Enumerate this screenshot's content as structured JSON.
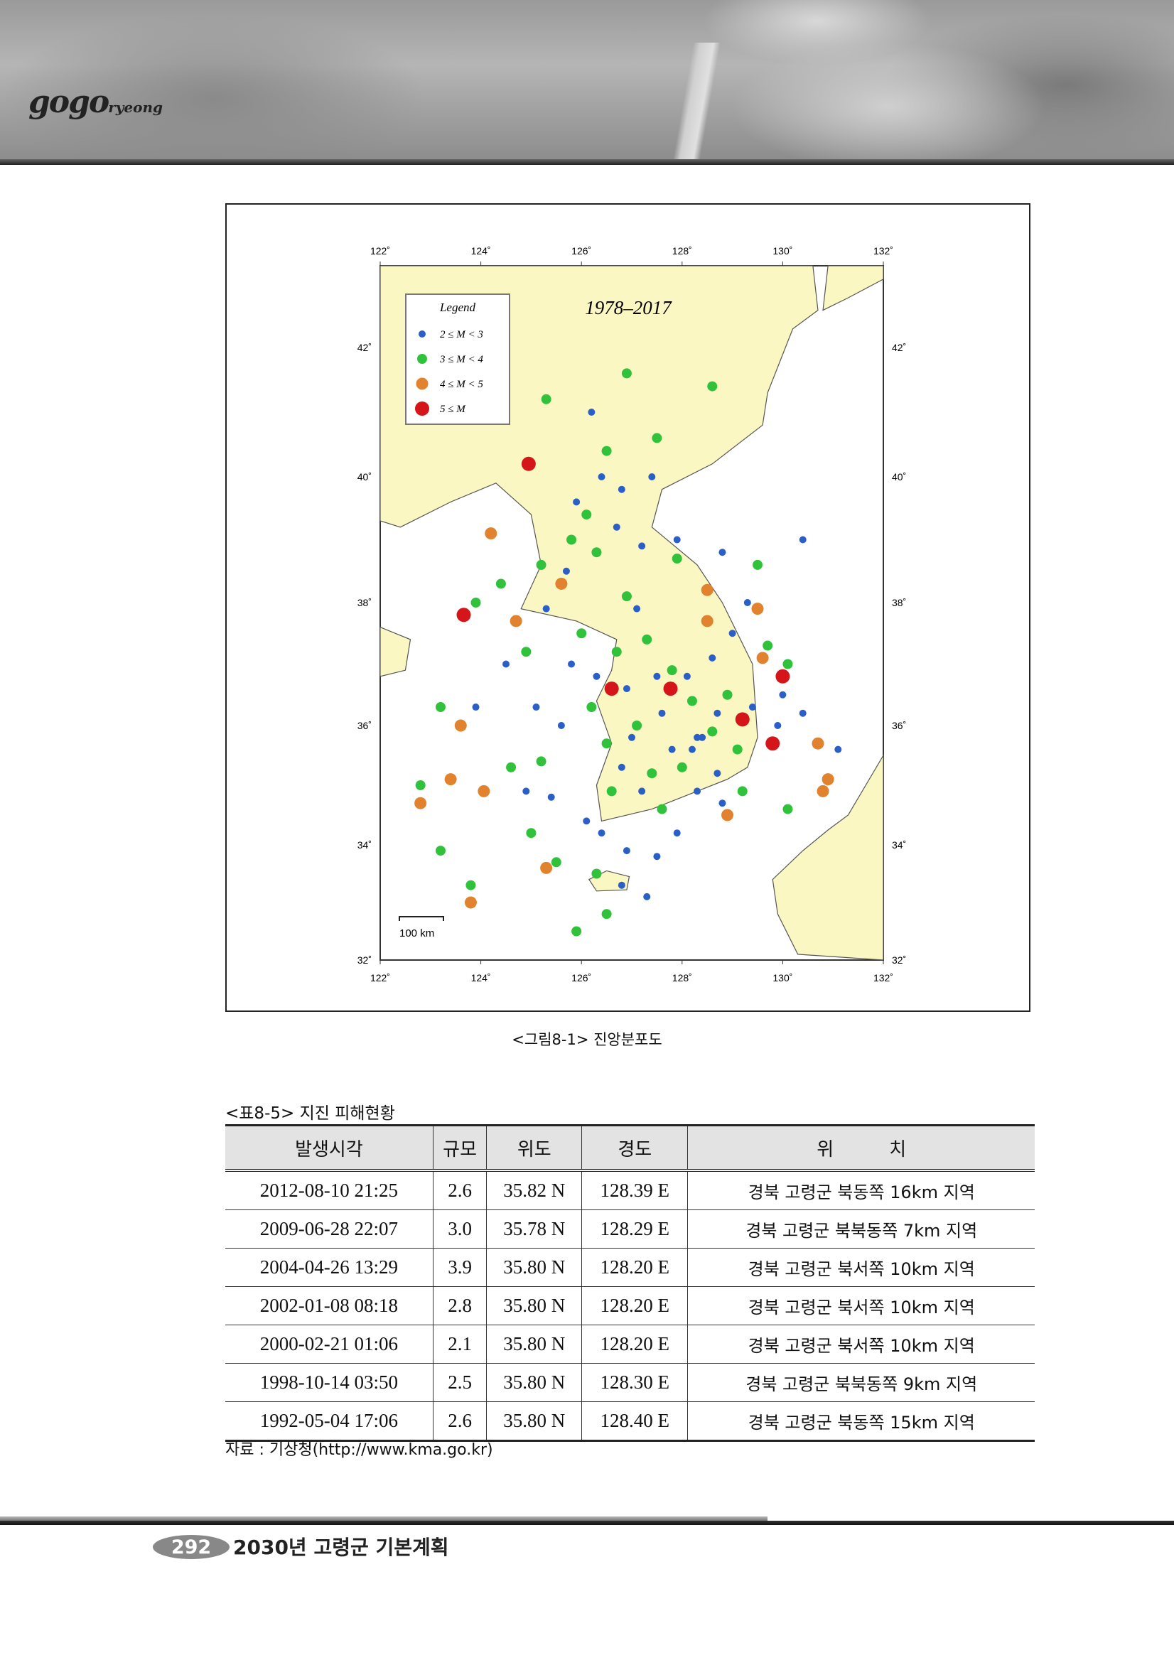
{
  "header": {
    "logo_text": "gogo goryeong"
  },
  "figure": {
    "caption": "<그림8-1> 진앙분포도",
    "map": {
      "period_label": "1978–2017",
      "legend_title": "Legend",
      "legend": [
        {
          "label": "2 ≤ M < 3",
          "color": "#2a5fc8"
        },
        {
          "label": "3 ≤ M < 4",
          "color": "#2fc23a"
        },
        {
          "label": "4 ≤ M < 5",
          "color": "#e0822e"
        },
        {
          "label": "5 ≤ M",
          "color": "#d4161a"
        }
      ],
      "lon_ticks": [
        "122˚",
        "124˚",
        "126˚",
        "128˚",
        "130˚",
        "132˚"
      ],
      "lat_ticks": [
        "32˚",
        "34˚",
        "36˚",
        "38˚",
        "40˚",
        "42˚"
      ],
      "scale_bar_label": "100 km",
      "land_color": "#fbf7c3",
      "epicenters": [
        [
          124.95,
          40.2,
          3
        ],
        [
          123.66,
          37.8,
          3
        ],
        [
          126.6,
          36.6,
          3
        ],
        [
          127.77,
          36.6,
          3
        ],
        [
          130.0,
          36.8,
          3
        ],
        [
          129.2,
          36.1,
          3
        ],
        [
          129.8,
          35.7,
          3
        ],
        [
          124.2,
          39.1,
          2
        ],
        [
          123.6,
          36.0,
          2
        ],
        [
          123.4,
          35.1,
          2
        ],
        [
          122.8,
          34.7,
          2
        ],
        [
          123.8,
          33.0,
          2
        ],
        [
          124.06,
          34.9,
          2
        ],
        [
          128.5,
          37.7,
          2
        ],
        [
          129.5,
          37.9,
          2
        ],
        [
          130.7,
          35.7,
          2
        ],
        [
          130.9,
          35.1,
          2
        ],
        [
          130.8,
          34.9,
          2
        ],
        [
          128.9,
          34.5,
          2
        ],
        [
          125.3,
          33.6,
          2
        ],
        [
          125.6,
          38.3,
          2
        ],
        [
          124.7,
          37.7,
          2
        ],
        [
          128.5,
          38.2,
          2
        ],
        [
          129.6,
          37.1,
          2
        ],
        [
          126.9,
          41.6,
          1
        ],
        [
          128.6,
          41.4,
          1
        ],
        [
          125.3,
          41.2,
          1
        ],
        [
          127.5,
          40.6,
          1
        ],
        [
          126.5,
          40.4,
          1
        ],
        [
          126.1,
          39.4,
          1
        ],
        [
          125.8,
          39.0,
          1
        ],
        [
          126.3,
          38.8,
          1
        ],
        [
          125.2,
          38.6,
          1
        ],
        [
          124.4,
          38.3,
          1
        ],
        [
          123.9,
          38.0,
          1
        ],
        [
          124.9,
          37.2,
          1
        ],
        [
          126.0,
          37.5,
          1
        ],
        [
          126.7,
          37.2,
          1
        ],
        [
          127.3,
          37.4,
          1
        ],
        [
          127.8,
          36.9,
          1
        ],
        [
          128.2,
          36.4,
          1
        ],
        [
          127.1,
          36.0,
          1
        ],
        [
          126.5,
          35.7,
          1
        ],
        [
          128.6,
          35.9,
          1
        ],
        [
          129.1,
          35.6,
          1
        ],
        [
          128.0,
          35.3,
          1
        ],
        [
          127.4,
          35.2,
          1
        ],
        [
          126.6,
          34.9,
          1
        ],
        [
          127.6,
          34.6,
          1
        ],
        [
          129.7,
          37.3,
          1
        ],
        [
          130.1,
          37.0,
          1
        ],
        [
          123.2,
          36.3,
          1
        ],
        [
          122.8,
          35.0,
          1
        ],
        [
          123.2,
          33.9,
          1
        ],
        [
          123.8,
          33.3,
          1
        ],
        [
          125.0,
          34.2,
          1
        ],
        [
          125.5,
          33.7,
          1
        ],
        [
          126.3,
          33.5,
          1
        ],
        [
          126.5,
          32.8,
          1
        ],
        [
          125.9,
          32.5,
          1
        ],
        [
          124.6,
          35.3,
          1
        ],
        [
          125.2,
          35.4,
          1
        ],
        [
          129.2,
          34.9,
          1
        ],
        [
          129.5,
          38.6,
          1
        ],
        [
          130.1,
          34.6,
          1
        ],
        [
          127.9,
          38.7,
          1
        ],
        [
          126.9,
          38.1,
          1
        ],
        [
          126.2,
          36.3,
          1
        ],
        [
          128.9,
          36.5,
          1
        ],
        [
          126.4,
          40.0,
          0
        ],
        [
          125.9,
          39.6,
          0
        ],
        [
          126.7,
          39.2,
          0
        ],
        [
          127.2,
          38.9,
          0
        ],
        [
          127.9,
          39.0,
          0
        ],
        [
          128.8,
          38.8,
          0
        ],
        [
          130.4,
          39.0,
          0
        ],
        [
          129.3,
          38.0,
          0
        ],
        [
          125.3,
          37.9,
          0
        ],
        [
          125.8,
          37.0,
          0
        ],
        [
          126.3,
          36.8,
          0
        ],
        [
          126.9,
          36.6,
          0
        ],
        [
          127.5,
          36.8,
          0
        ],
        [
          128.1,
          36.8,
          0
        ],
        [
          128.7,
          36.2,
          0
        ],
        [
          127.6,
          36.2,
          0
        ],
        [
          127.0,
          35.8,
          0
        ],
        [
          128.3,
          35.8,
          0
        ],
        [
          128.4,
          35.8,
          0
        ],
        [
          128.2,
          35.6,
          0
        ],
        [
          127.8,
          35.6,
          0
        ],
        [
          126.8,
          35.3,
          0
        ],
        [
          127.2,
          34.9,
          0
        ],
        [
          128.3,
          34.9,
          0
        ],
        [
          128.7,
          35.2,
          0
        ],
        [
          129.4,
          36.3,
          0
        ],
        [
          129.9,
          36.0,
          0
        ],
        [
          130.4,
          36.2,
          0
        ],
        [
          131.1,
          35.6,
          0
        ],
        [
          125.6,
          36.0,
          0
        ],
        [
          125.1,
          36.3,
          0
        ],
        [
          124.5,
          37.0,
          0
        ],
        [
          126.4,
          34.2,
          0
        ],
        [
          126.9,
          33.9,
          0
        ],
        [
          127.5,
          33.8,
          0
        ],
        [
          127.3,
          33.1,
          0
        ],
        [
          126.8,
          33.3,
          0
        ],
        [
          125.4,
          34.8,
          0
        ],
        [
          123.9,
          36.3,
          0
        ],
        [
          125.7,
          38.5,
          0
        ],
        [
          126.8,
          39.8,
          0
        ],
        [
          127.4,
          40.0,
          0
        ],
        [
          126.2,
          41.0,
          0
        ],
        [
          127.1,
          37.9,
          0
        ],
        [
          128.6,
          37.1,
          0
        ],
        [
          129.0,
          37.5,
          0
        ],
        [
          130.0,
          36.5,
          0
        ],
        [
          124.9,
          34.9,
          0
        ],
        [
          126.1,
          34.4,
          0
        ],
        [
          128.8,
          34.7,
          0
        ],
        [
          127.9,
          34.2,
          0
        ]
      ]
    }
  },
  "table": {
    "title": "<표8-5> 지진 피해현황",
    "headers": [
      "발생시각",
      "규모",
      "위도",
      "경도",
      "위　　　치"
    ],
    "rows": [
      [
        "2012-08-10 21:25",
        "2.6",
        "35.82 N",
        "128.39 E",
        "경북 고령군 북동쪽 16km 지역"
      ],
      [
        "2009-06-28 22:07",
        "3.0",
        "35.78 N",
        "128.29 E",
        "경북 고령군 북북동쪽 7km 지역"
      ],
      [
        "2004-04-26 13:29",
        "3.9",
        "35.80 N",
        "128.20 E",
        "경북 고령군 북서쪽 10km 지역"
      ],
      [
        "2002-01-08 08:18",
        "2.8",
        "35.80 N",
        "128.20 E",
        "경북 고령군 북서쪽 10km 지역"
      ],
      [
        "2000-02-21 01:06",
        "2.1",
        "35.80 N",
        "128.20 E",
        "경북 고령군 북서쪽 10km 지역"
      ],
      [
        "1998-10-14 03:50",
        "2.5",
        "35.80 N",
        "128.30 E",
        "경북 고령군 북북동쪽 9km 지역"
      ],
      [
        "1992-05-04 17:06",
        "2.6",
        "35.80 N",
        "128.40 E",
        "경북 고령군 북동쪽 15km 지역"
      ]
    ],
    "source": "자료 : 기상청(http://www.kma.go.kr)"
  },
  "footer": {
    "page_number": "292",
    "document_title": "2030년 고령군 기본계획"
  }
}
